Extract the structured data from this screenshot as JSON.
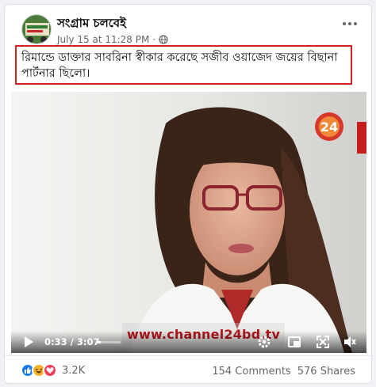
{
  "post": {
    "page_name": "সংগ্রাম চলবেই",
    "timestamp": "July 15 at 11:28 PM",
    "separator": "·",
    "privacy_icon": "globe-icon",
    "more_icon": "more-options-icon",
    "caption": "রিমান্ডে ডাক্তার  সাবরিনা স্বীকার করেছে সজীব ওয়াজেদ জয়ের বিছানা পার্টনার ছিলো।",
    "caption_border_color": "#d32020"
  },
  "video": {
    "channel_logo_text": "24",
    "watermark_url": "www.channel24bd.tv",
    "current_time": "0:33",
    "time_separator": "/",
    "duration": "3:07",
    "progress_fraction": 0.18,
    "controls": [
      "play-icon",
      "settings-gear-icon",
      "pip-icon",
      "fullscreen-icon",
      "volume-icon"
    ]
  },
  "engagement": {
    "reactions": [
      "like-icon",
      "haha-icon",
      "love-icon"
    ],
    "reaction_count": "3.2K",
    "comments": "154 Comments",
    "shares": "576 Shares"
  },
  "colors": {
    "like_blue": "#1877f2",
    "haha_yellow": "#f7b125",
    "love_red": "#f33e58",
    "watermark_red": "#b3161b"
  }
}
